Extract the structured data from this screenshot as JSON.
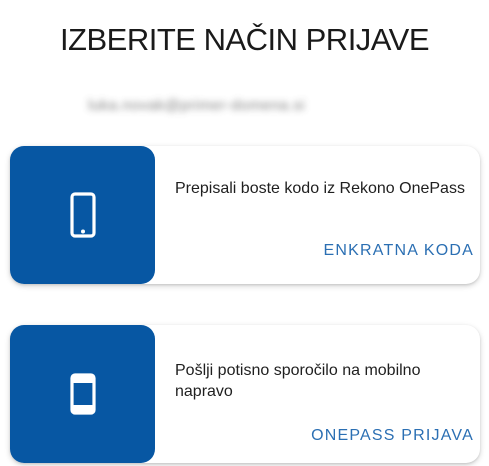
{
  "page": {
    "title": "IZBERITE NAČIN PRIJAVE",
    "email_masked": "luka.novak@primer-domena.si"
  },
  "options": [
    {
      "icon": "smartphone-icon",
      "description": "Prepisali boste kodo iz Rekono OnePass",
      "action_label": "ENKRATNA KODA"
    },
    {
      "icon": "mobile-app-icon",
      "description": "Pošlji potisno sporočilo na mobilno napravo",
      "action_label": "ONEPASS PRIJAVA"
    }
  ],
  "colors": {
    "brand_blue": "#0757a3",
    "action_blue": "#2b6fb3"
  }
}
